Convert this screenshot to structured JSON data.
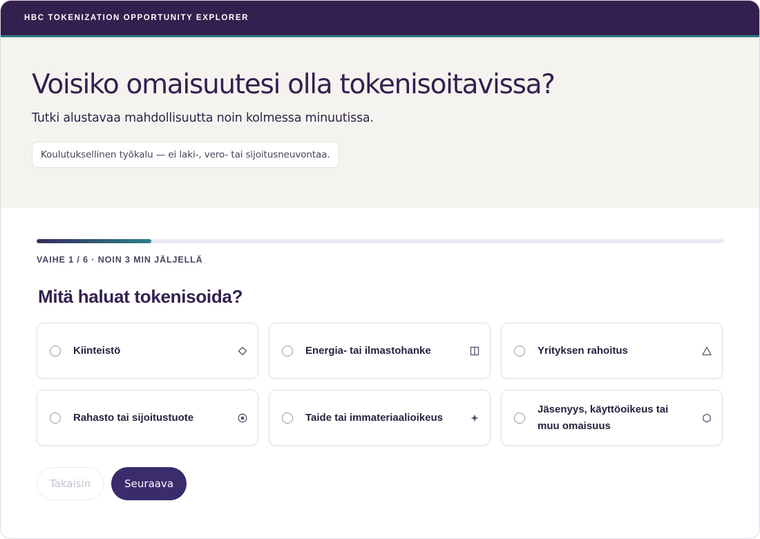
{
  "header": {
    "brand": "HBC TOKENIZATION OPPORTUNITY EXPLORER"
  },
  "hero": {
    "title": "Voisiko omaisuutesi olla tokenisoitavissa?",
    "subtitle": "Tutki alustavaa mahdollisuutta noin kolmessa minuutissa.",
    "disclaimer": "Koulutuksellinen työkalu — ei laki-, vero- tai sijoitusneuvontaa."
  },
  "progress": {
    "fraction": 0.167,
    "label": "VAIHE 1 / 6 · NOIN 3 MIN JÄLJELLÄ"
  },
  "question": {
    "title": "Mitä haluat tokenisoida?",
    "options": [
      {
        "label": "Kiinteistö",
        "icon": "diamond-icon"
      },
      {
        "label": "Energia- tai ilmastohanke",
        "icon": "panel-icon"
      },
      {
        "label": "Yrityksen rahoitus",
        "icon": "triangle-icon"
      },
      {
        "label": "Rahasto tai sijoitustuote",
        "icon": "target-icon"
      },
      {
        "label": "Taide tai immateriaalioikeus",
        "icon": "sparkle-icon"
      },
      {
        "label": "Jäsenyys, käyttöoikeus tai muu omaisuus",
        "icon": "hexagon-icon"
      }
    ]
  },
  "actions": {
    "back_label": "Takaisin",
    "next_label": "Seuraava"
  },
  "colors": {
    "header_bg": "#33204e",
    "accent_teal": "#2f7f86",
    "primary_button": "#3b2c6c",
    "hero_bg": "#f4f3ef"
  }
}
